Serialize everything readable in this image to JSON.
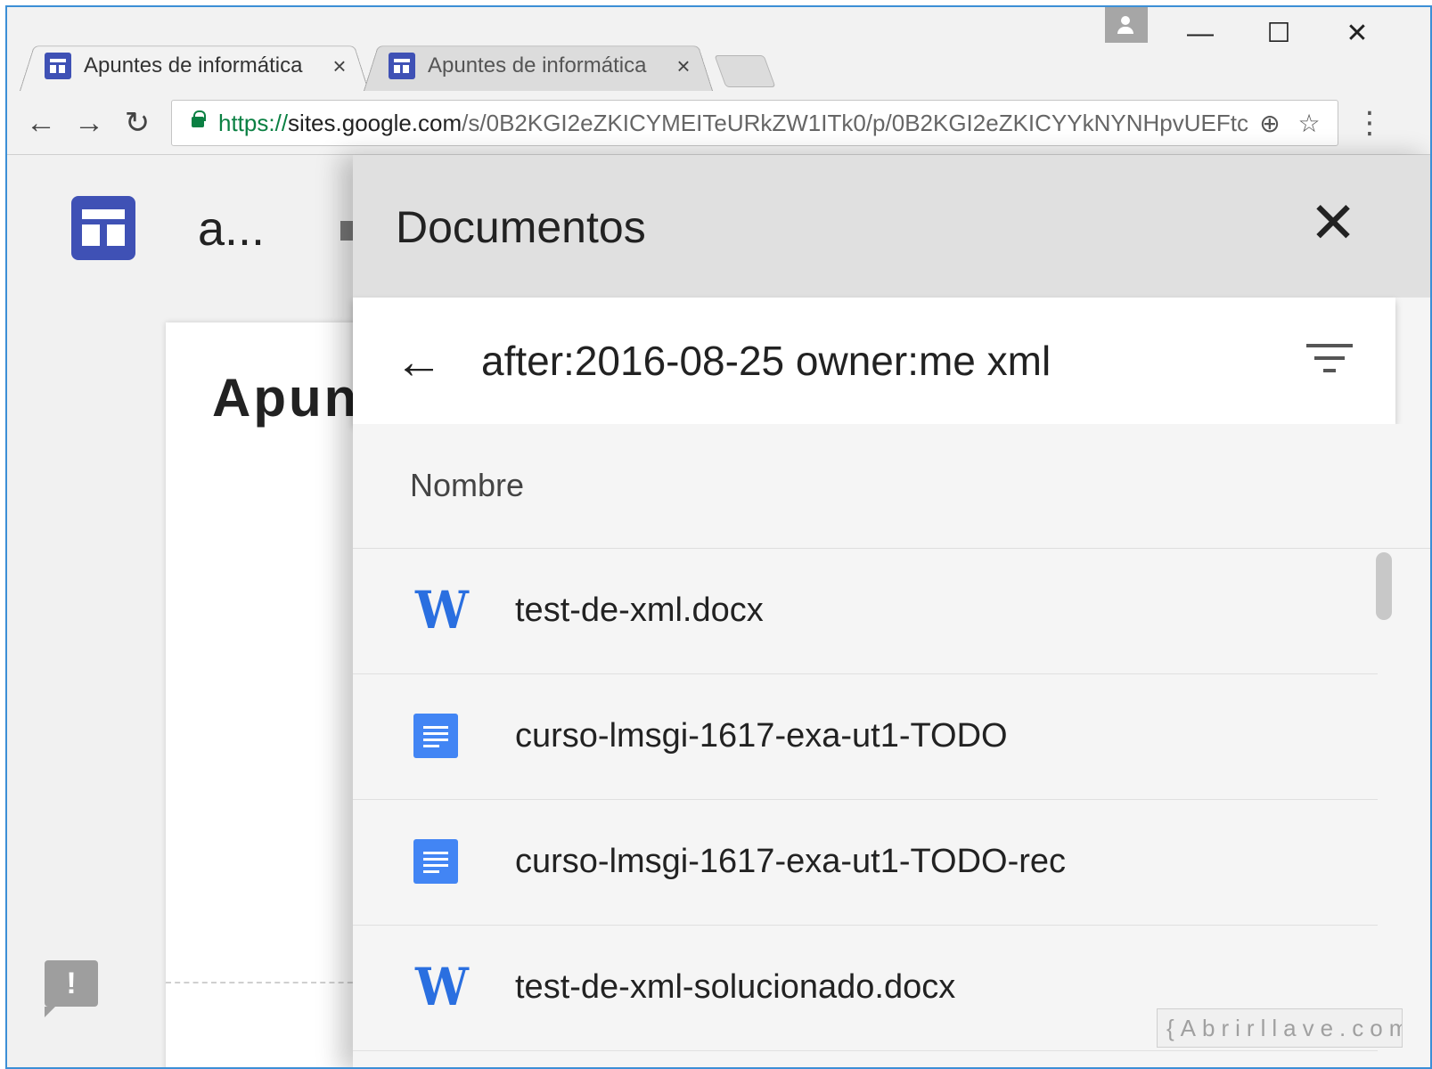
{
  "browser": {
    "tabs": [
      {
        "title": "Apuntes de informática",
        "close": "×",
        "active": true
      },
      {
        "title": "Apuntes de informática",
        "close": "×",
        "active": false
      }
    ],
    "window_controls": {
      "minimize": "—",
      "maximize": "☐",
      "close": "✕"
    },
    "nav": {
      "back": "←",
      "forward": "→",
      "reload": "↻"
    },
    "address": {
      "scheme": "https://",
      "host": "sites.google.com",
      "path": "/s/0B2KGI2eZKICYMEITeURkZW1ITk0/p/0B2KGI2eZKICYYkNYNHpvUEFtc"
    },
    "omnibox_icons": {
      "zoom": "⊕",
      "bookmark": "☆"
    },
    "menu": "⋮"
  },
  "site": {
    "title": "a...",
    "page_heading": "Apun",
    "feedback_icon": "!"
  },
  "drawer": {
    "title": "Documentos",
    "close": "✕",
    "search": {
      "back": "←",
      "query": "after:2016-08-25 owner:me xml"
    },
    "column_header": "Nombre",
    "files": [
      {
        "icon": "word",
        "icon_glyph": "W",
        "name": "test-de-xml.docx"
      },
      {
        "icon": "doc",
        "icon_glyph": "",
        "name": "curso-lmsgi-1617-exa-ut1-TODO"
      },
      {
        "icon": "doc",
        "icon_glyph": "",
        "name": "curso-lmsgi-1617-exa-ut1-TODO-rec"
      },
      {
        "icon": "word",
        "icon_glyph": "W",
        "name": "test-de-xml-solucionado.docx"
      }
    ]
  },
  "watermark": "{Abrirllave.com",
  "colors": {
    "accent": "#3f51b5",
    "doc_blue": "#4285f4",
    "word_blue": "#2a6fe0",
    "secure_green": "#0b8043"
  }
}
